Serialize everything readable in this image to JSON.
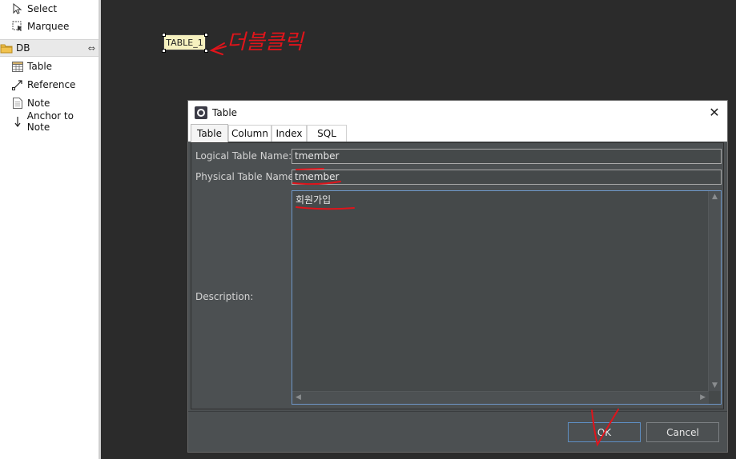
{
  "palette": {
    "items": [
      {
        "label": "Select",
        "icon": "cursor-icon"
      },
      {
        "label": "Marquee",
        "icon": "marquee-icon"
      },
      {
        "label": "DB",
        "icon": "folder-icon",
        "drawer": true
      },
      {
        "label": "Table",
        "icon": "table-icon"
      },
      {
        "label": "Reference",
        "icon": "reference-icon"
      },
      {
        "label": "Note",
        "icon": "note-icon"
      },
      {
        "label": "Anchor to Note",
        "icon": "anchor-icon"
      }
    ]
  },
  "canvas": {
    "table_node_label": "TABLE_1",
    "annotation_text": "더블클릭"
  },
  "dialog": {
    "title": "Table",
    "tabs": [
      "Table",
      "Column",
      "Index",
      "SQL"
    ],
    "active_tab": "Table",
    "fields": {
      "logical_label": "Logical Table Name:",
      "logical_value": "tmember",
      "physical_label": "Physical Table Name:",
      "physical_value": "tmember",
      "description_label": "Description:",
      "description_value": "회원가입"
    },
    "ok_label": "OK",
    "cancel_label": "Cancel"
  },
  "colors": {
    "canvas_bg": "#2b2b2b",
    "dialog_bg": "#4c5052",
    "table_node_bg": "#f6f1bf",
    "annotation_red": "#e0141b",
    "focus_blue": "#5e8fc4"
  }
}
